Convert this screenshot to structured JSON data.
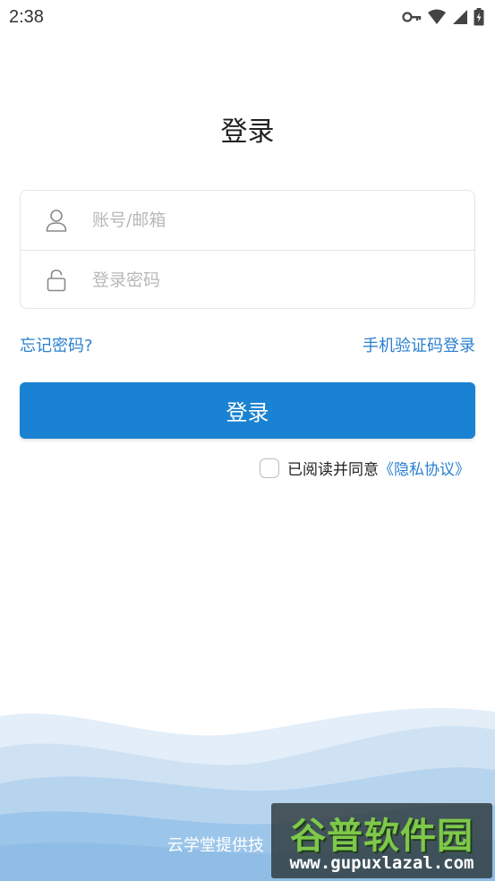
{
  "status_bar": {
    "time": "2:38",
    "icons": [
      "key-icon",
      "wifi-icon",
      "signal-icon",
      "battery-icon"
    ]
  },
  "title": "登录",
  "form": {
    "account_placeholder": "账号/邮箱",
    "password_placeholder": "登录密码",
    "account_icon": "user-icon",
    "password_icon": "lock-icon"
  },
  "links": {
    "forgot_password": "忘记密码?",
    "sms_login": "手机验证码登录"
  },
  "login_button": "登录",
  "agreement": {
    "checked": false,
    "text": "已阅读并同意",
    "privacy_link": "《隐私协议》"
  },
  "footer": {
    "text": "云学堂提供技"
  },
  "watermark": {
    "title": "谷普软件园",
    "url": "www.gupuxlazal.com"
  },
  "colors": {
    "accent": "#1a82d2",
    "link": "#2a7fcf",
    "wave_light": "#e3eef9",
    "wave_mid": "#b7d4ef",
    "wave_dark": "#8fbde6"
  }
}
